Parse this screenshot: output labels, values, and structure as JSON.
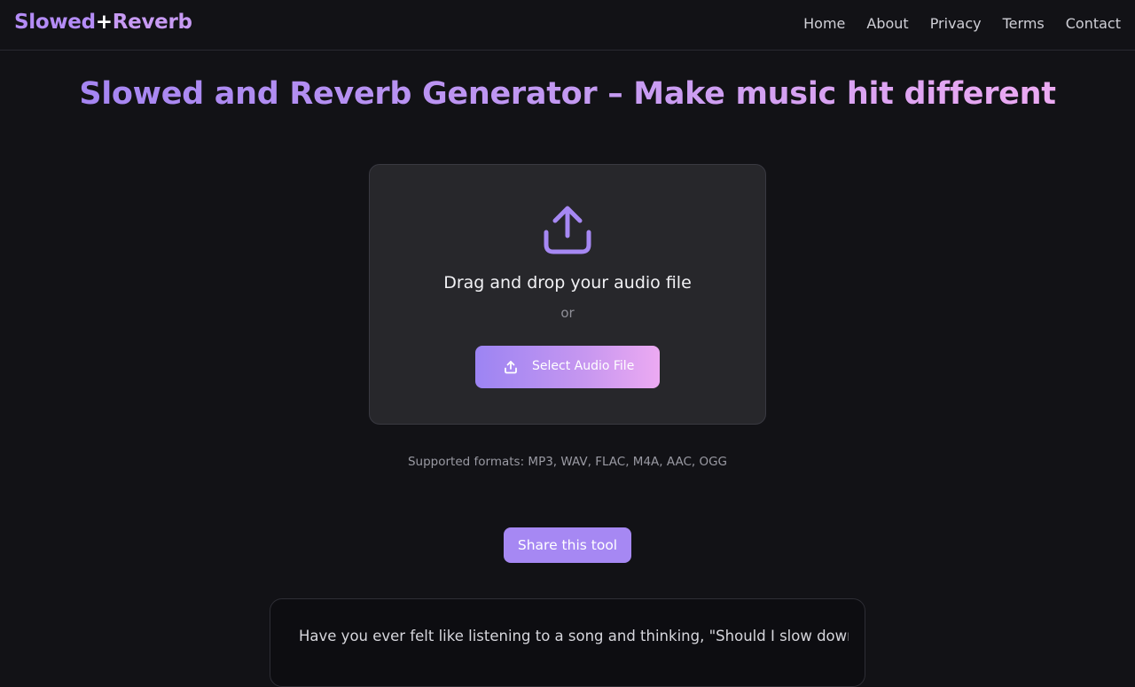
{
  "header": {
    "logo_part1": "Slowed",
    "logo_plus": "+",
    "logo_part2": "Reverb",
    "nav": [
      {
        "label": "Home"
      },
      {
        "label": "About"
      },
      {
        "label": "Privacy"
      },
      {
        "label": "Terms"
      },
      {
        "label": "Contact"
      }
    ]
  },
  "main": {
    "title": "Slowed and Reverb Generator – Make music hit different",
    "dropzone": {
      "icon": "upload-icon",
      "heading": "Drag and drop your audio file",
      "or_text": "or",
      "select_button_label": "Select Audio File"
    },
    "supported_formats": "Supported formats: MP3, WAV, FLAC, M4A, AAC, OGG",
    "share_button_label": "Share this tool",
    "article_intro": "Have you ever felt like listening to a song and thinking, \"Should I slow down its"
  },
  "colors": {
    "background": "#121216",
    "accent_purple": "#a688f3",
    "accent_pink": "#ecaaf2",
    "card": "#27272b"
  }
}
